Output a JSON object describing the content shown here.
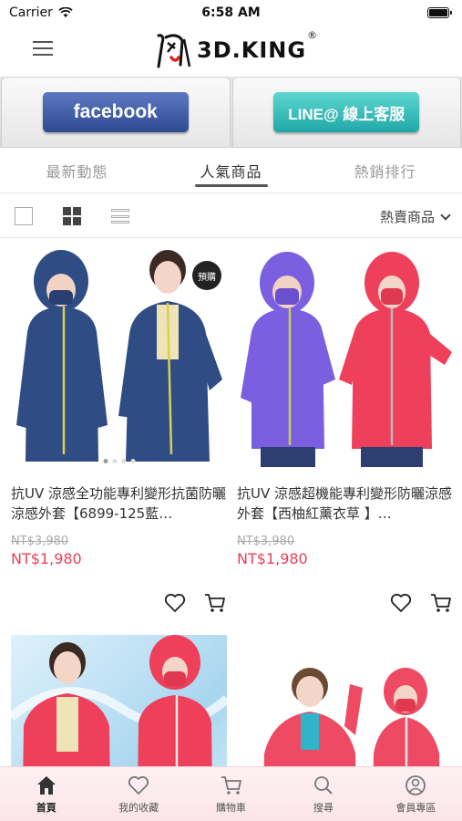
{
  "status": {
    "carrier": "Carrier",
    "time": "6:58 AM"
  },
  "header": {
    "logo_text": "3D.KING",
    "logo_reg": "®"
  },
  "social": {
    "facebook_label": "facebook",
    "line_label": "LINE@ 線上客服"
  },
  "tabs": [
    {
      "label": "最新動態",
      "active": false
    },
    {
      "label": "人氣商品",
      "active": true
    },
    {
      "label": "熱銷排行",
      "active": false
    }
  ],
  "toolbar": {
    "sort_label": "熱賣商品"
  },
  "products": [
    {
      "title": "抗UV 涼感全功能專利變形抗菌防曬涼感外套【6899-125藍…",
      "old_price": "NT$3,980",
      "price": "NT$1,980",
      "badge": "預購",
      "jacket_color": "#2f4c85",
      "zip_color": "#d8d24a"
    },
    {
      "title": "抗UV 涼感超機能專利變形防曬涼感外套【西柚紅薰衣草 】…",
      "old_price": "NT$3,980",
      "price": "NT$1,980",
      "badge": "",
      "jacket_color": "#7a5fe0",
      "zip_color": "#c7d04a"
    },
    {
      "title": "",
      "old_price": "",
      "price": "",
      "badge": "",
      "jacket_color": "#ee3f5b",
      "zip_color": "#e7e7e7"
    },
    {
      "title": "",
      "old_price": "",
      "price": "",
      "badge": "",
      "jacket_color": "#ef4a63",
      "zip_color": "#e7e7e7"
    }
  ],
  "tabbar": [
    {
      "label": "首頁",
      "icon": "home-icon",
      "active": true
    },
    {
      "label": "我的收藏",
      "icon": "heart-icon",
      "active": false
    },
    {
      "label": "購物車",
      "icon": "cart-icon",
      "active": false
    },
    {
      "label": "搜尋",
      "icon": "search-icon",
      "active": false
    },
    {
      "label": "會員專區",
      "icon": "user-icon",
      "active": false
    }
  ],
  "colors": {
    "price": "#e94057",
    "tabbar_bg": "#fbe5ea"
  }
}
